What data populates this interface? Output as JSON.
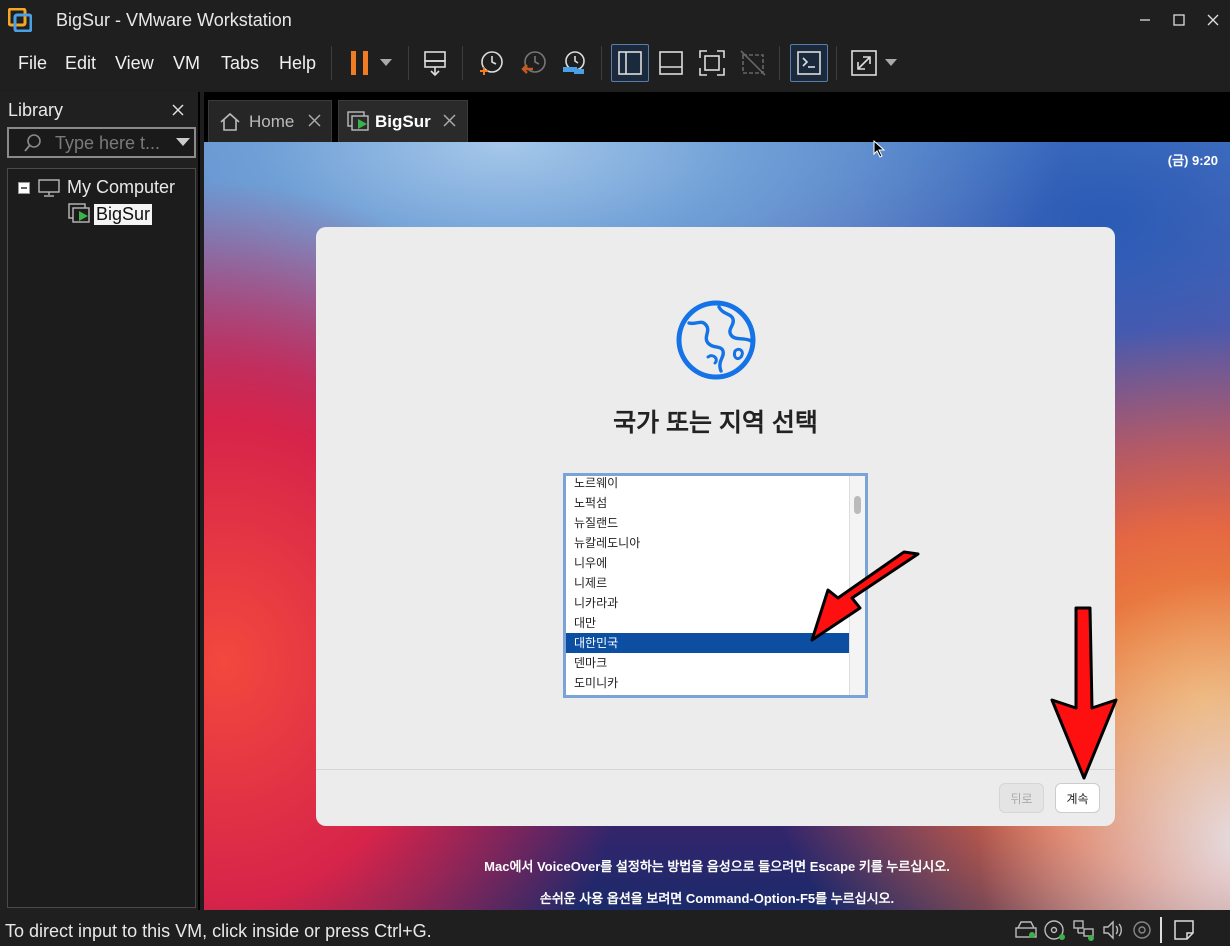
{
  "window": {
    "title": "BigSur - VMware Workstation"
  },
  "menu": [
    "File",
    "Edit",
    "View",
    "VM",
    "Tabs",
    "Help"
  ],
  "library": {
    "title": "Library",
    "search_placeholder": "Type here t...",
    "tree": {
      "root": "My Computer",
      "child": "BigSur"
    }
  },
  "tabs": [
    {
      "label": "Home",
      "active": false
    },
    {
      "label": "BigSur",
      "active": true
    }
  ],
  "vm": {
    "clock": "(금)  9:20",
    "dialog": {
      "title": "국가 또는 지역 선택",
      "countries": [
        "노르웨이",
        "노퍽섬",
        "뉴질랜드",
        "뉴칼레도니아",
        "니우에",
        "니제르",
        "니카라과",
        "대만",
        "대한민국",
        "덴마크",
        "도미니카"
      ],
      "selected": "대한민국",
      "back_label": "뒤로",
      "continue_label": "계속"
    },
    "hints": [
      "Mac에서 VoiceOver를 설정하는 방법을 음성으로 들으려면 Escape 키를 누르십시오.",
      "손쉬운 사용 옵션을 보려면 Command-Option-F5를 누르십시오."
    ]
  },
  "status": {
    "text": "To direct input to this VM, click inside or press Ctrl+G."
  },
  "colors": {
    "accent_blue": "#1473e6",
    "selection": "#0b4ea2",
    "pause_orange": "#f07d24",
    "annotation_red": "#ff1010"
  }
}
